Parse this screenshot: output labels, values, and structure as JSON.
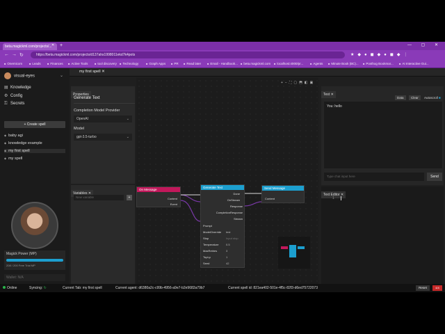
{
  "browser": {
    "tab_title": "beta.magickml.com/projects/...",
    "url": "https://beta.magickml.com/projects/d137ahs1998011ekd7k4pots",
    "bookmarks": [
      "Onemicom",
      "Leads",
      "Finances",
      "Active Tools",
      "tool discovery",
      "Technology",
      "Graph Apps",
      "PR",
      "Read later",
      "Email - Handbook...",
      "beta.magickml.com",
      "localhost:4000/pr...",
      "Agents",
      "Minute Book (BC)...",
      "Posthog Bookmar...",
      "AI Interactive Gui..."
    ]
  },
  "sidebar": {
    "project": "visual-eyes",
    "nav": [
      {
        "label": "Knowledge",
        "icon": "book-icon"
      },
      {
        "label": "Config",
        "icon": "gear-icon"
      },
      {
        "label": "Secrets",
        "icon": "key-icon"
      }
    ],
    "create_label": "+ Create spell",
    "spells": [
      "baby agi",
      "knowledge example",
      "my first spell",
      "my spell"
    ],
    "power_label": "Magick Power (MP)",
    "power_sub": "208 / 200 Free Trial MP",
    "power_fraction": 1.0,
    "wallet": "Wallet: N/A"
  },
  "topbar": {
    "spell_tab": "my first spell"
  },
  "properties": {
    "header": "Properties",
    "node_title": "Generate Text",
    "provider_label": "Completion Model Provider",
    "provider_value": "OpenAI",
    "model_label": "Model",
    "model_value": "gpt-3.5-turbo"
  },
  "variables": {
    "header": "Variables",
    "placeholder": "New variable",
    "add_label": "+"
  },
  "nodes": {
    "on_message": {
      "title": "On Message",
      "color": "#c2185b",
      "outputs": [
        "Content",
        "Event"
      ]
    },
    "generate_text": {
      "title": "Generate Text",
      "color": "#1c9fcf",
      "outputs": [
        "Done",
        "OnStream",
        "Response",
        "CompletionResponse",
        "Stream"
      ],
      "inputs": [
        "Prompt",
        "ModelOverride",
        "Stop",
        "Temperature",
        "MaxRetries",
        "TopLp",
        "Seed"
      ],
      "values": {
        "ModelOverride": "test",
        "Stop": "Input stop",
        "Temperature": "0.5",
        "MaxRetries": "3",
        "TopLp": "1",
        "Seed": "42"
      }
    },
    "send_message": {
      "title": "Send Message",
      "color": "#1c9fcf",
      "inputs": [
        "Content"
      ]
    }
  },
  "test": {
    "header": "Test",
    "data_label": "Data",
    "clear_label": "Clear",
    "autoscroll_label": "Autoscroll",
    "log": "You: hello",
    "input_placeholder": "Type chat input here",
    "send_label": "Send"
  },
  "editor": {
    "header": "Text Editor",
    "line": "1"
  },
  "status": {
    "online": "Online",
    "syncing": "Syncing:",
    "current_tab": "Current Tab: my first spell",
    "current_agent": "Current agent: d6380a2c-c99b-4956-a9e7-b2e9682a79b7",
    "current_spell": "Current spell id: 821ea402-501e-4f5c-82f3-d6ed75722073",
    "reset_label": "Reset",
    "warn_label": "4/4"
  }
}
